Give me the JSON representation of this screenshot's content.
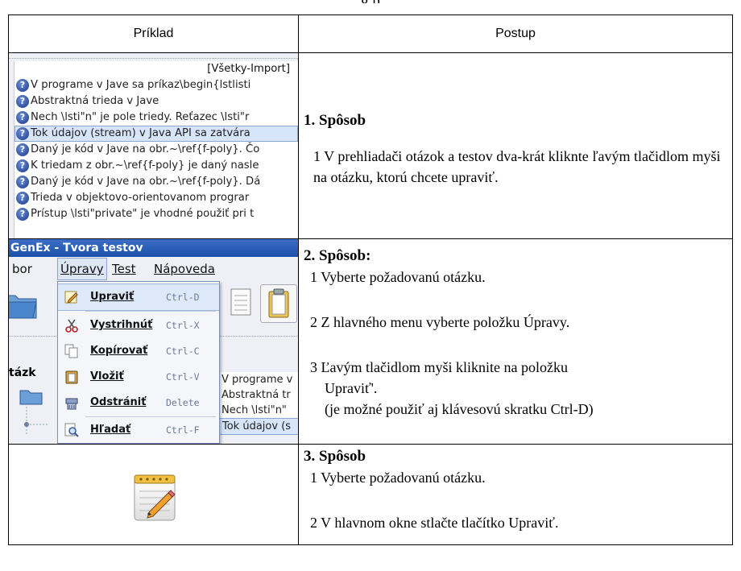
{
  "page": {
    "heading_fragment": "g  p"
  },
  "table": {
    "header_left": "Príklad",
    "header_right": "Postup"
  },
  "shot1": {
    "header": "[Všetky-Import]",
    "rows": [
      "V programe v Jave sa príkaz\\begin{lstlisti",
      "Abstraktná trieda v Jave",
      "Nech \\lsti\"n\" je pole triedy. Reťazec \\lsti\"r",
      "Tok údajov (stream) v Java API sa zatvára",
      "Daný je kód v Jave na obr.~\\ref{f-poly}. Čo",
      "K triedam z obr.~\\ref{f-poly} je daný nasle",
      "Daný je kód v Jave na obr.~\\ref{f-poly}. Dá",
      "Trieda v objektovo-orientovanom prograr",
      "Prístup \\lsti\"private\" je vhodné použiť pri t"
    ],
    "selected_row": 3
  },
  "shot2": {
    "title": "GenEx - Tvora testov",
    "menubar": {
      "item0": "bor",
      "item1": "Úpravy",
      "item2": "Test",
      "item3": "Nápoveda"
    },
    "pane_label": "tázk",
    "menu_items": [
      {
        "label": "Upraviť",
        "key": "Ctrl-D",
        "icon": "edit-icon"
      },
      {
        "label": "Vystrihnúť",
        "key": "Ctrl-X",
        "icon": "scissors-icon"
      },
      {
        "label": "Kopírovať",
        "key": "Ctrl-C",
        "icon": "copy-icon"
      },
      {
        "label": "Vložiť",
        "key": "Ctrl-V",
        "icon": "paste-icon"
      },
      {
        "label": "Odstrániť",
        "key": "Delete",
        "icon": "delete-icon"
      },
      {
        "label": "Hľadať",
        "key": "Ctrl-F",
        "icon": "search-icon"
      }
    ],
    "list": [
      "V programe v",
      "Abstraktná tr",
      "Nech \\lsti\"n\"",
      "Tok údajov (s"
    ]
  },
  "method1": {
    "title": "1. Spôsob",
    "step1": "1 V prehliadači otázok a testov dva-krát kliknte ľavým tlačidlom myši na otázku, ktorú chcete upraviť."
  },
  "method2": {
    "title": "2. Spôsob:",
    "step1": "1 Vyberte požadovanú otázku.",
    "step2": "2  Z hlavného menu vyberte položku Úpravy.",
    "step3a": "3  Ľavým tlačidlom myši kliknite na položku",
    "step3b": "Upraviť'.",
    "step3c": "(je možné použiť aj klávesovú skratku Ctrl-D)"
  },
  "method3": {
    "title": "3. Spôsob",
    "step1": "1 Vyberte požadovanú otázku.",
    "step2": "2  V  hlavnom okne stlačte tlačítko Upraviť."
  }
}
